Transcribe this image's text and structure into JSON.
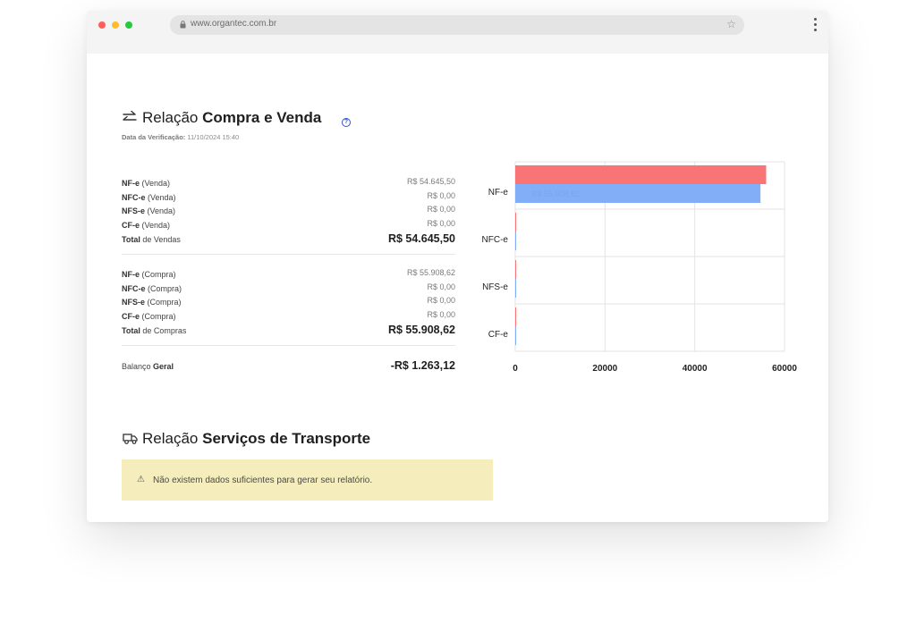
{
  "browser": {
    "url": "www.organtec.com.br"
  },
  "compra_venda": {
    "title_prefix": "Relação",
    "title_bold": "Compra e Venda",
    "help_glyph": "?",
    "verification_label": "Data da Verificação:",
    "verification_date": "11/10/2024 15:40",
    "vendas": [
      {
        "doc": "NF-e",
        "kind": "(Venda)",
        "value": "R$ 54.645,50"
      },
      {
        "doc": "NFC-e",
        "kind": "(Venda)",
        "value": "R$ 0,00"
      },
      {
        "doc": "NFS-e",
        "kind": "(Venda)",
        "value": "R$ 0,00"
      },
      {
        "doc": "CF-e",
        "kind": "(Venda)",
        "value": "R$ 0,00"
      }
    ],
    "total_vendas": {
      "bold": "Total",
      "rest": "de Vendas",
      "value": "R$ 54.645,50"
    },
    "compras": [
      {
        "doc": "NF-e",
        "kind": "(Compra)",
        "value": "R$ 55.908,62"
      },
      {
        "doc": "NFC-e",
        "kind": "(Compra)",
        "value": "R$ 0,00"
      },
      {
        "doc": "NFS-e",
        "kind": "(Compra)",
        "value": "R$ 0,00"
      },
      {
        "doc": "CF-e",
        "kind": "(Compra)",
        "value": "R$ 0,00"
      }
    ],
    "total_compras": {
      "bold": "Total",
      "rest": "de Compras",
      "value": "R$ 55.908,62"
    },
    "balanco": {
      "label": "Balanço",
      "bold": "Geral",
      "value": "-R$ 1.263,12"
    }
  },
  "chart_data": {
    "type": "bar",
    "orientation": "horizontal",
    "categories": [
      "NF-e",
      "NFC-e",
      "NFS-e",
      "CF-e"
    ],
    "series": [
      {
        "color": "#f97474",
        "values": [
          55908.62,
          0,
          0,
          0
        ]
      },
      {
        "color": "#82aef8",
        "values": [
          54645.5,
          0,
          0,
          0
        ]
      }
    ],
    "xlim": [
      0,
      60000
    ],
    "xticks": [
      "0",
      "20000",
      "40000",
      "60000"
    ],
    "tooltip_text": "R$ 55.908,62",
    "grid": true
  },
  "transporte": {
    "title_prefix": "Relação",
    "title_bold": "Serviços de Transporte",
    "alert_icon": "⚠",
    "alert_message": "Não existem dados suficientes para gerar seu relatório."
  }
}
